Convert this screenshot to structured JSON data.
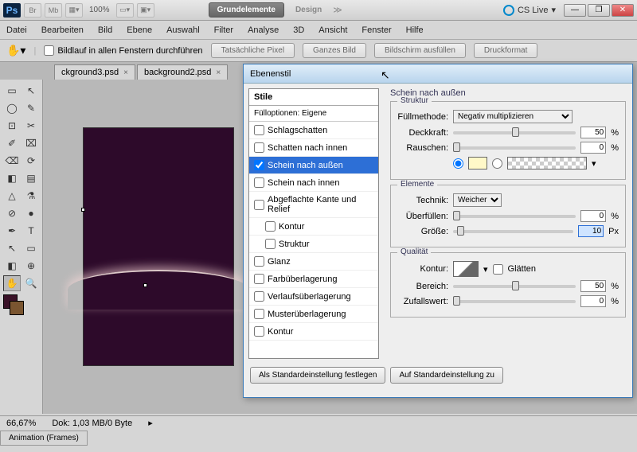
{
  "app": {
    "logo": "Ps",
    "zoom": "100%",
    "workspace_active": "Grundelemente",
    "workspace_inactive": "Design",
    "cs_live": "CS Live"
  },
  "menu": [
    "Datei",
    "Bearbeiten",
    "Bild",
    "Ebene",
    "Auswahl",
    "Filter",
    "Analyse",
    "3D",
    "Ansicht",
    "Fenster",
    "Hilfe"
  ],
  "options": {
    "scroll_all": "Bildlauf in allen Fenstern durchführen",
    "buttons": [
      "Tatsächliche Pixel",
      "Ganzes Bild",
      "Bildschirm ausfüllen",
      "Druckformat"
    ]
  },
  "tabs": [
    "ckground3.psd",
    "background2.psd"
  ],
  "tools": [
    "▭",
    "↖",
    "◯",
    "✎",
    "⊡",
    "✂",
    "✐",
    "⌧",
    "⌫",
    "⟳",
    "◧",
    "▤",
    "△",
    "⚗",
    "⊘",
    "●",
    "✒",
    "T",
    "↖",
    "▭",
    "◧",
    "⊕",
    "✋",
    "🔍"
  ],
  "status": {
    "zoom": "66,67%",
    "doc_info": "Dok: 1,03 MB/0 Byte"
  },
  "anim_panel": "Animation (Frames)",
  "dialog": {
    "title": "Ebenenstil",
    "styles_header": "Stile",
    "blend_options": "Fülloptionen: Eigene",
    "items": [
      {
        "label": "Schlagschatten",
        "checked": false
      },
      {
        "label": "Schatten nach innen",
        "checked": false
      },
      {
        "label": "Schein nach außen",
        "checked": true,
        "selected": true
      },
      {
        "label": "Schein nach innen",
        "checked": false
      },
      {
        "label": "Abgeflachte Kante und Relief",
        "checked": false
      },
      {
        "label": "Kontur",
        "checked": false,
        "indent": true
      },
      {
        "label": "Struktur",
        "checked": false,
        "indent": true
      },
      {
        "label": "Glanz",
        "checked": false
      },
      {
        "label": "Farbüberlagerung",
        "checked": false
      },
      {
        "label": "Verlaufsüberlagerung",
        "checked": false
      },
      {
        "label": "Musterüberlagerung",
        "checked": false
      },
      {
        "label": "Kontur",
        "checked": false
      }
    ],
    "panel_title": "Schein nach außen",
    "struktur": {
      "title": "Struktur",
      "blend_label": "Füllmethode:",
      "blend_value": "Negativ multiplizieren",
      "opacity_label": "Deckkraft:",
      "opacity_value": "50",
      "noise_label": "Rauschen:",
      "noise_value": "0",
      "pct": "%"
    },
    "elemente": {
      "title": "Elemente",
      "tech_label": "Technik:",
      "tech_value": "Weicher",
      "spread_label": "Überfüllen:",
      "spread_value": "0",
      "size_label": "Größe:",
      "size_value": "10",
      "px": "Px",
      "pct": "%"
    },
    "qualitaet": {
      "title": "Qualität",
      "contour_label": "Kontur:",
      "antialias": "Glätten",
      "range_label": "Bereich:",
      "range_value": "50",
      "jitter_label": "Zufallswert:",
      "jitter_value": "0",
      "pct": "%"
    },
    "buttons": {
      "default": "Als Standardeinstellung festlegen",
      "reset": "Auf Standardeinstellung zu"
    }
  }
}
